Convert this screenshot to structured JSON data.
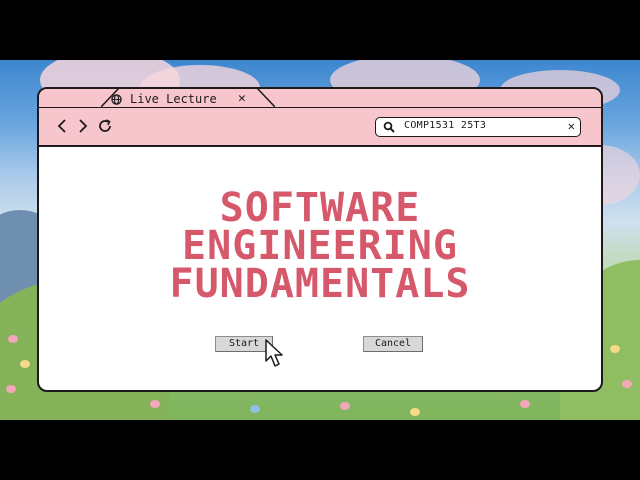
{
  "tab": {
    "title": "Live Lecture",
    "icon": "globe-icon",
    "close_icon": "close-icon"
  },
  "toolbar": {
    "back_icon": "chevron-left-icon",
    "forward_icon": "chevron-right-icon",
    "reload_icon": "reload-icon",
    "search_value": "COMP1531 25T3",
    "search_icon": "search-icon",
    "clear_icon": "close-icon"
  },
  "main": {
    "title_line1": "SOFTWARE",
    "title_line2": "ENGINEERING",
    "title_line3": "FUNDAMENTALS",
    "start_label": "Start",
    "cancel_label": "Cancel"
  },
  "colors": {
    "accent": "#d6596b",
    "chrome": "#f7c5cc",
    "outline": "#1e1a1c"
  }
}
